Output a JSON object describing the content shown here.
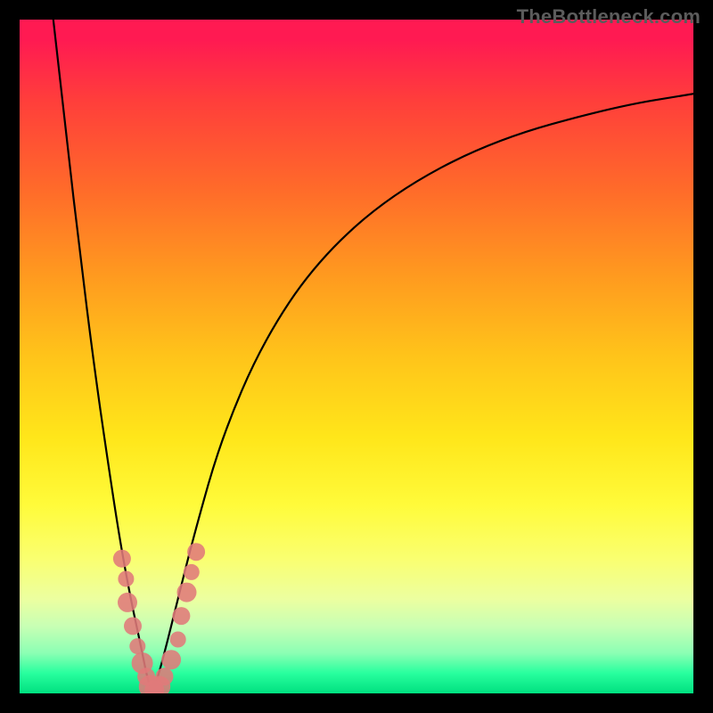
{
  "watermark": "TheBottleneck.com",
  "colors": {
    "frame": "#000000",
    "dot": "#e07a7a",
    "curve": "#000000",
    "gradient_top": "#ff1a52",
    "gradient_bottom": "#00e080"
  },
  "chart_data": {
    "type": "line",
    "title": "",
    "xlabel": "",
    "ylabel": "",
    "xlim": [
      0,
      100
    ],
    "ylim": [
      0,
      100
    ],
    "grid": false,
    "legend": false,
    "note": "V-shaped curve (two branches) with sample points clustered near the vertex. No axis ticks or labels are shown; y-value scale inferred from vertical extent (0=bottom, 100=top).",
    "series": [
      {
        "name": "left_branch",
        "x": [
          5,
          7,
          9,
          11,
          13,
          15,
          16.5,
          18,
          19,
          19.8
        ],
        "y": [
          100,
          82,
          65,
          49,
          35,
          22,
          14,
          7,
          2,
          0
        ]
      },
      {
        "name": "right_branch",
        "x": [
          19.8,
          21,
          23,
          26,
          30,
          36,
          44,
          55,
          70,
          88,
          100
        ],
        "y": [
          0,
          4,
          12,
          24,
          38,
          52,
          64,
          74,
          82,
          87,
          89
        ]
      }
    ],
    "sample_points": {
      "name": "marked_points",
      "x": [
        15.2,
        15.8,
        16.0,
        16.8,
        17.5,
        18.2,
        18.8,
        19.4,
        20.0,
        20.8,
        21.5,
        22.5,
        23.5,
        24.0,
        24.8,
        25.5,
        26.2
      ],
      "y": [
        20.0,
        17.0,
        13.5,
        10.0,
        7.0,
        4.5,
        2.5,
        1.0,
        0.5,
        1.0,
        2.5,
        5.0,
        8.0,
        11.5,
        15.0,
        18.0,
        21.0
      ],
      "r": [
        10,
        9,
        11,
        10,
        9,
        12,
        10,
        13,
        11,
        12,
        10,
        11,
        9,
        10,
        11,
        9,
        10
      ]
    }
  }
}
